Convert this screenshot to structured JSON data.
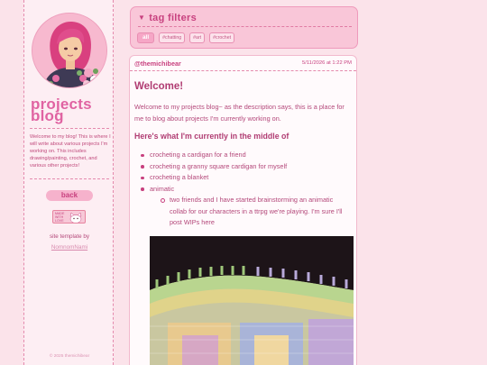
{
  "sidebar": {
    "title_line1": "projects",
    "title_line2": "blog",
    "description": "Welcome to my blog! This is where I will write about various projects I'm working on. This includes drawing/painting, crochet, and various other projects!",
    "back_label": "back",
    "badge_text": "MADE WITH LOVE",
    "credit_label": "site template by",
    "credit_link": "NomnomNami",
    "copyright": "© 2025 themichibear"
  },
  "tag_filters": {
    "title": "tag filters",
    "tags": [
      "all",
      "#chatting",
      "#art",
      "#crochet"
    ],
    "active_tag": "all"
  },
  "post": {
    "username": "@themichibear",
    "date": "5/11/2026 at 1:22 PM",
    "title": "Welcome!",
    "intro": "Welcome to my projects blog~ as the description says, this is a place for me to blog about projects I'm currently working on.",
    "subheading": "Here's what I'm currently in the middle of",
    "items": [
      "crocheting a cardigan for a friend",
      "crocheting a granny square cardigan for myself",
      "crocheting a blanket",
      "animatic"
    ],
    "subitems": [
      "two friends and I have started brainstorming an animatic collab for our characters in a ttrpg we're playing. I'm sure I'll post WIPs here"
    ]
  },
  "colors": {
    "background": "#fbe3ea",
    "accent": "#e063a2",
    "text": "#b4487a"
  }
}
